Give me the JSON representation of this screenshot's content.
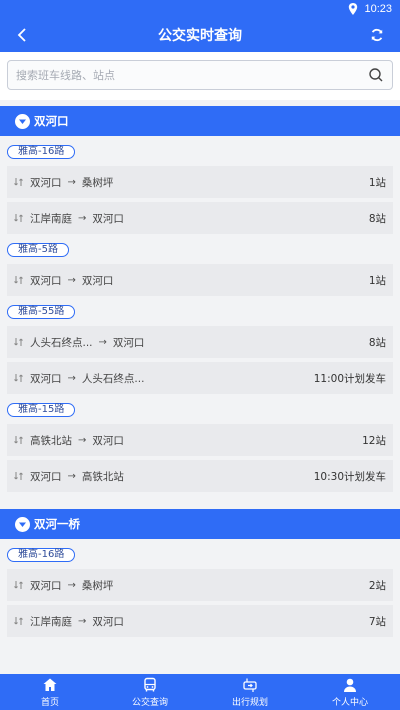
{
  "statusbar": {
    "time": "10:23"
  },
  "header": {
    "title": "公交实时查询"
  },
  "search": {
    "placeholder": "搜索班车线路、站点"
  },
  "stations": [
    {
      "name": "双河口",
      "routes": [
        {
          "name": "雅高-16路",
          "trips": [
            {
              "from": "双河口",
              "to": "桑树坪",
              "stops": "1站"
            },
            {
              "from": "江岸南庭",
              "to": "双河口",
              "stops": "8站"
            }
          ]
        },
        {
          "name": "雅高-5路",
          "trips": [
            {
              "from": "双河口",
              "to": "双河口",
              "stops": "1站"
            }
          ]
        },
        {
          "name": "雅高-55路",
          "trips": [
            {
              "from": "人头石终点...",
              "to": "双河口",
              "stops": "8站"
            },
            {
              "from": "双河口",
              "to": "人头石终点...",
              "stops": "11:00计划发车"
            }
          ]
        },
        {
          "name": "雅高-15路",
          "trips": [
            {
              "from": "高铁北站",
              "to": "双河口",
              "stops": "12站"
            },
            {
              "from": "双河口",
              "to": "高铁北站",
              "stops": "10:30计划发车"
            }
          ]
        }
      ]
    },
    {
      "name": "双河一桥",
      "routes": [
        {
          "name": "雅高-16路",
          "trips": [
            {
              "from": "双河口",
              "to": "桑树坪",
              "stops": "2站"
            },
            {
              "from": "江岸南庭",
              "to": "双河口",
              "stops": "7站"
            }
          ]
        }
      ]
    }
  ],
  "tabbar": [
    {
      "label": "首页",
      "icon": "home-icon"
    },
    {
      "label": "公交查询",
      "icon": "bus-icon"
    },
    {
      "label": "出行规划",
      "icon": "route-plan-icon"
    },
    {
      "label": "个人中心",
      "icon": "person-icon"
    }
  ],
  "colors": {
    "primary": "#2f6cf6",
    "row_bg": "#e9eaed"
  }
}
